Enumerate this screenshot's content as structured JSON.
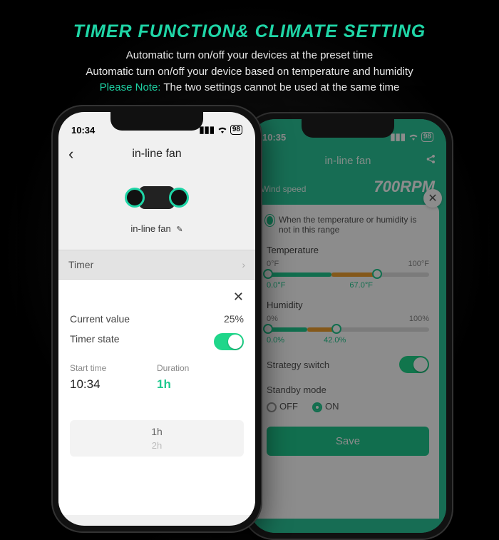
{
  "hero": {
    "title": "TIMER FUNCTION& CLIMATE SETTING",
    "line1": "Automatic turn on/off your devices at the preset time",
    "line2": "Automatic turn on/off your device based on temperature and humidity",
    "note_prefix": "Please Note:",
    "note_rest": " The two settings cannot be used at the same time"
  },
  "phone1": {
    "status_time": "10:34",
    "battery": "98",
    "nav_title": "in-line fan",
    "device_name": "in-line fan",
    "timer_label": "Timer",
    "current_value_label": "Current value",
    "current_value": "25%",
    "timer_state_label": "Timer state",
    "timer_state_on": true,
    "start_time_label": "Start time",
    "start_time": "10:34",
    "duration_label": "Duration",
    "duration": "1h",
    "picker_selected": "1h",
    "picker_next": "2h"
  },
  "phone2": {
    "status_time": "10:35",
    "nav_title": "in-line fan",
    "wind_label": "Wind speed",
    "rpm": "700RPM",
    "condition_text": "When the temperature or humidity is not in this range",
    "temperature": {
      "label": "Temperature",
      "min_label": "0°F",
      "max_label": "100°F",
      "low": "0.0°F",
      "high": "67.0°F",
      "low_pct": 0,
      "high_pct": 67
    },
    "humidity": {
      "label": "Humidity",
      "min_label": "0%",
      "max_label": "100%",
      "low": "0.0%",
      "high": "42.0%",
      "low_pct": 0,
      "high_pct": 42
    },
    "strategy_label": "Strategy switch",
    "strategy_on": true,
    "standby_label": "Standby mode",
    "standby_off_label": "OFF",
    "standby_on_label": "ON",
    "standby_value": "ON",
    "save_label": "Save"
  }
}
